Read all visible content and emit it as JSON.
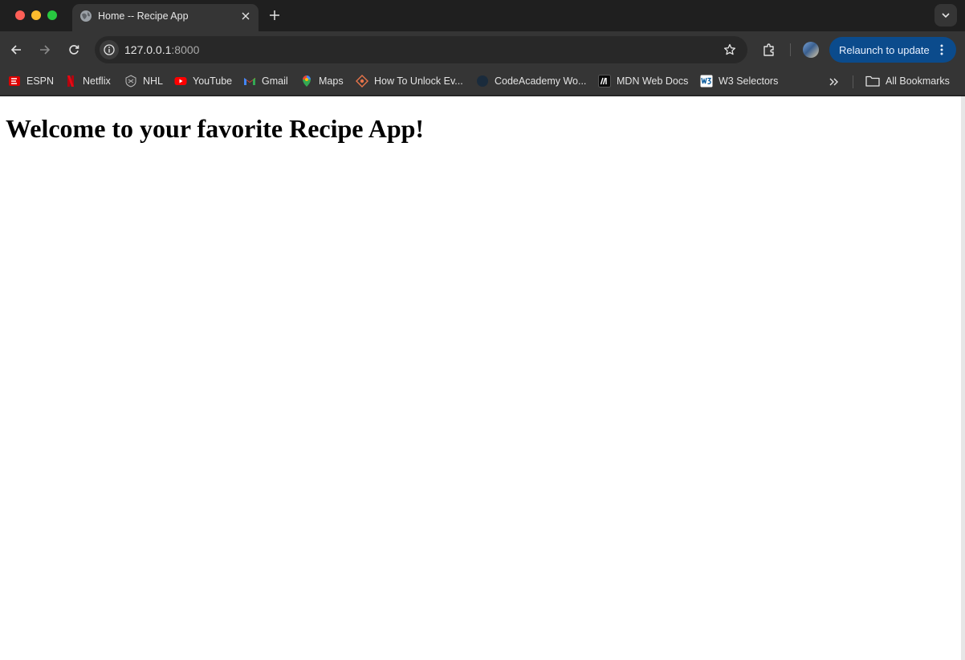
{
  "browser": {
    "tab": {
      "title": "Home -- Recipe App",
      "favicon": "globe-icon"
    },
    "address_bar": {
      "host": "127.0.0.1",
      "port": ":8000"
    },
    "relaunch_label": "Relaunch to update",
    "accent_color": "#0b4b8c"
  },
  "bookmarks": {
    "items": [
      {
        "label": "ESPN",
        "icon": "espn-icon"
      },
      {
        "label": "Netflix",
        "icon": "netflix-icon"
      },
      {
        "label": "NHL",
        "icon": "nhl-icon"
      },
      {
        "label": "YouTube",
        "icon": "youtube-icon"
      },
      {
        "label": "Gmail",
        "icon": "gmail-icon"
      },
      {
        "label": "Maps",
        "icon": "maps-icon"
      },
      {
        "label": "How To Unlock Ev...",
        "icon": "unlock-guide-icon"
      },
      {
        "label": "CodeAcademy Wo...",
        "icon": "codeacademy-icon"
      },
      {
        "label": "MDN Web Docs",
        "icon": "mdn-icon"
      },
      {
        "label": "W3 Selectors",
        "icon": "w3-icon"
      }
    ],
    "all_bookmarks_label": "All Bookmarks"
  },
  "page": {
    "heading": "Welcome to your favorite Recipe App!"
  }
}
